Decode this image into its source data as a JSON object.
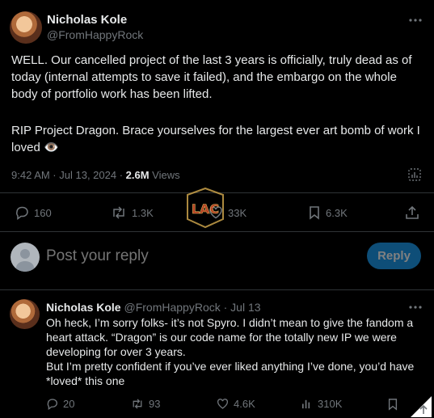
{
  "main_post": {
    "author_name": "Nicholas Kole",
    "author_handle": "@FromHappyRock",
    "paragraph1": "WELL. Our cancelled project of the last 3 years is officially, truly dead as of today (internal attempts to save it failed), and the embargo on the whole body of portfolio work has been lifted.",
    "paragraph2": "RIP Project Dragon. Brace yourselves for the largest ever art bomb of work I loved 👁️",
    "timestamp": "9:42 AM · Jul 13, 2024 · ",
    "views_count": "2.6M",
    "views_label": " Views",
    "stats": {
      "replies": "160",
      "reposts": "1.3K",
      "likes": "33K",
      "bookmarks": "6.3K"
    }
  },
  "composer": {
    "placeholder": "Post your reply",
    "button_label": "Reply"
  },
  "reply_post": {
    "author_name": "Nicholas Kole",
    "author_handle": "@FromHappyRock",
    "date": "· Jul 13",
    "text_line1": "Oh heck, I’m sorry folks- it’s not Spyro. I didn’t mean to give the fandom a heart attack. “Dragon” is our code name for the totally new IP we were developing for over 3 years.",
    "text_line2": "But I’m pretty confident if you’ve ever liked anything I’ve done, you’d have *loved* this one",
    "stats": {
      "replies": "20",
      "reposts": "93",
      "likes": "4.6K",
      "views": "310K"
    }
  },
  "watermark": {
    "text": "LAC"
  },
  "colors": {
    "background": "#000000",
    "text": "#e7e9ea",
    "muted": "#71767b",
    "accent": "#1d9bf0"
  }
}
